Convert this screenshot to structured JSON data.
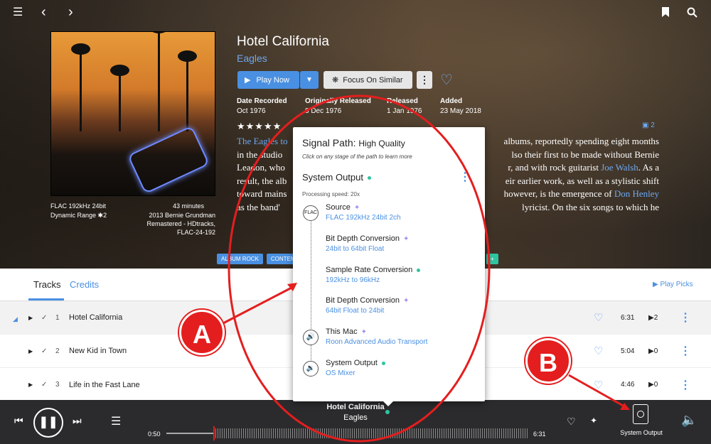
{
  "album": {
    "title": "Hotel California",
    "artist": "Eagles",
    "play_label": "Play Now",
    "focus_label": "Focus On Similar",
    "dates": [
      {
        "k": "Date Recorded",
        "v": "Oct 1976"
      },
      {
        "k": "Originally Released",
        "v": "8 Dec 1976"
      },
      {
        "k": "Released",
        "v": "1 Jan 1976"
      },
      {
        "k": "Added",
        "v": "23 May 2018"
      }
    ],
    "cover_meta": {
      "format": "FLAC 192kHz 24bit",
      "duration": "43 minutes",
      "dynamic": "Dynamic Range ✱2",
      "remaster1": "2013 Bernie Grundman",
      "remaster2": "Remastered - HDtracks,",
      "remaster3": "FLAC-24-192"
    },
    "images_count": "2",
    "review": [
      "The Eagles to",
      "albums, reportedly spending eight months",
      "in the studio",
      "lso their first to be made without Bernie",
      "Leadon, who",
      "r, and with rock guitarist",
      "Joe Walsh",
      ". As a",
      "result, the alb",
      "eir earlier work, as well as a stylistic shift",
      "toward mains",
      "however, is the emergence of",
      "Don Henley",
      "as the band'",
      "lyricist. On the six songs to which he"
    ],
    "tags": [
      "ALBUM ROCK",
      "CONTEMP",
      "+"
    ]
  },
  "tabs": {
    "tracks": "Tracks",
    "credits": "Credits",
    "play_picks": "Play Picks"
  },
  "tracks": [
    {
      "n": "1",
      "title": "Hotel California",
      "dur": "6:31",
      "plays": "2"
    },
    {
      "n": "2",
      "title": "New Kid in Town",
      "dur": "5:04",
      "plays": "0"
    },
    {
      "n": "3",
      "title": "Life in the Fast Lane",
      "dur": "4:46",
      "plays": "0"
    }
  ],
  "signal": {
    "title": "Signal Path:",
    "quality": "High Quality",
    "hint": "Click on any stage of the path to learn more",
    "zone": "System Output",
    "speed": "Processing speed: 20x",
    "stages": [
      {
        "name": "Source",
        "sub": "FLAC 192kHz 24bit 2ch",
        "icon": "FLAC"
      },
      {
        "name": "Bit Depth Conversion",
        "sub": "24bit to 64bit Float"
      },
      {
        "name": "Sample Rate Conversion",
        "sub": "192kHz to 96kHz"
      },
      {
        "name": "Bit Depth Conversion",
        "sub": "64bit Float to 24bit"
      },
      {
        "name": "This Mac",
        "sub": "Roon Advanced Audio Transport"
      },
      {
        "name": "System Output",
        "sub": "OS Mixer"
      }
    ]
  },
  "player": {
    "track": "Hotel California",
    "artist": "Eagles",
    "elapsed": "0:50",
    "total": "6:31",
    "zone": "System Output",
    "progress": 0.13
  },
  "callouts": {
    "a": "A",
    "b": "B"
  }
}
